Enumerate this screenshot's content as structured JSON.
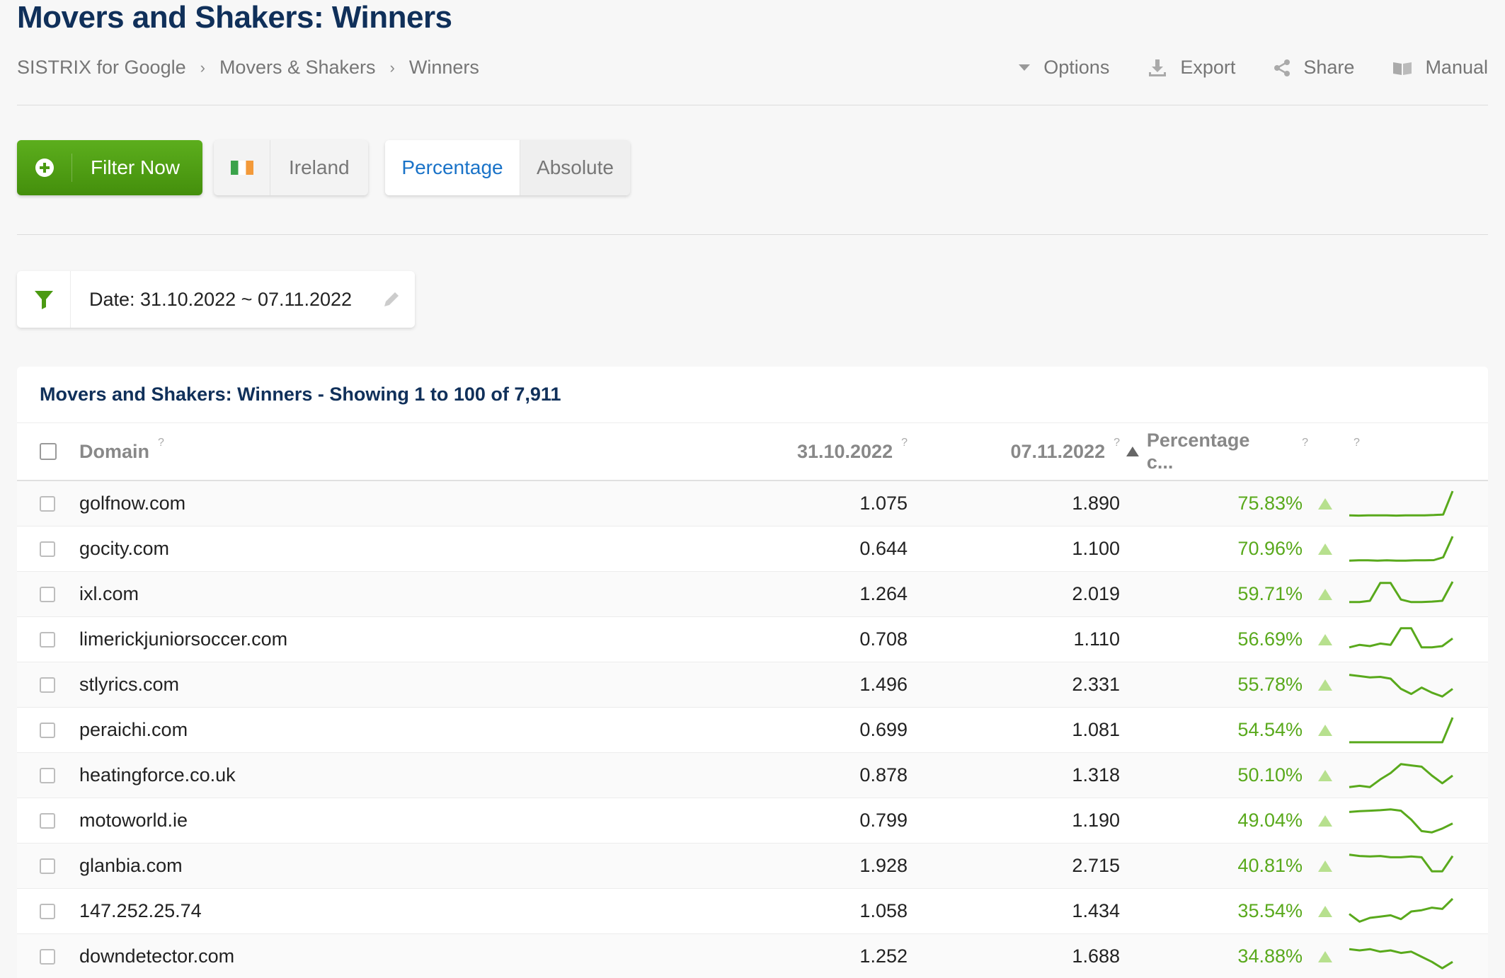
{
  "header": {
    "title": "Movers and Shakers: Winners",
    "breadcrumb": [
      "SISTRIX for Google",
      "Movers & Shakers",
      "Winners"
    ],
    "tools": {
      "options": "Options",
      "export": "Export",
      "share": "Share",
      "manual": "Manual"
    }
  },
  "controls": {
    "filter_button": "Filter Now",
    "country": "Ireland",
    "mode_active": "Percentage",
    "mode_inactive": "Absolute",
    "date_filter": "Date: 31.10.2022 ~ 07.11.2022"
  },
  "colors": {
    "accent_green": "#59a91c",
    "title_blue": "#10305a",
    "link_blue": "#1a73c8"
  },
  "table": {
    "caption": "Movers and Shakers: Winners - Showing 1 to 100 of 7,911",
    "headers": {
      "domain": "Domain",
      "date1": "31.10.2022",
      "date2": "07.11.2022",
      "change": "Percentage c...",
      "help": "?"
    },
    "rows": [
      {
        "domain": "golfnow.com",
        "v1": "1.075",
        "v2": "1.890",
        "pct": "75.83%",
        "spark": [
          0.05,
          0.04,
          0.05,
          0.05,
          0.05,
          0.04,
          0.05,
          0.05,
          0.05,
          0.06,
          0.08,
          1.0
        ]
      },
      {
        "domain": "gocity.com",
        "v1": "0.644",
        "v2": "1.100",
        "pct": "70.96%",
        "spark": [
          0.05,
          0.06,
          0.06,
          0.05,
          0.06,
          0.05,
          0.05,
          0.06,
          0.06,
          0.07,
          0.18,
          1.0
        ]
      },
      {
        "domain": "ixl.com",
        "v1": "1.264",
        "v2": "2.019",
        "pct": "59.71%",
        "spark": [
          0.2,
          0.2,
          0.25,
          0.95,
          0.95,
          0.3,
          0.2,
          0.2,
          0.22,
          0.25,
          1.0
        ]
      },
      {
        "domain": "limerickjuniorsoccer.com",
        "v1": "0.708",
        "v2": "1.110",
        "pct": "56.69%",
        "spark": [
          0.2,
          0.3,
          0.25,
          0.35,
          0.3,
          0.95,
          0.95,
          0.2,
          0.2,
          0.25,
          0.55
        ]
      },
      {
        "domain": "stlyrics.com",
        "v1": "1.496",
        "v2": "2.331",
        "pct": "55.78%",
        "spark": [
          0.9,
          0.85,
          0.8,
          0.82,
          0.75,
          0.35,
          0.15,
          0.4,
          0.2,
          0.05,
          0.35
        ]
      },
      {
        "domain": "peraichi.com",
        "v1": "0.699",
        "v2": "1.081",
        "pct": "54.54%",
        "spark": [
          0.03,
          0.03,
          0.03,
          0.03,
          0.03,
          0.03,
          0.03,
          0.03,
          0.03,
          0.03,
          1.0
        ]
      },
      {
        "domain": "heatingforce.co.uk",
        "v1": "0.878",
        "v2": "1.318",
        "pct": "50.10%",
        "spark": [
          0.05,
          0.1,
          0.05,
          0.35,
          0.6,
          0.95,
          0.9,
          0.85,
          0.5,
          0.2,
          0.5
        ]
      },
      {
        "domain": "motoworld.ie",
        "v1": "0.799",
        "v2": "1.190",
        "pct": "49.04%",
        "spark": [
          0.85,
          0.88,
          0.9,
          0.92,
          0.95,
          0.9,
          0.55,
          0.1,
          0.05,
          0.2,
          0.4
        ]
      },
      {
        "domain": "glanbia.com",
        "v1": "1.928",
        "v2": "2.715",
        "pct": "40.81%",
        "spark": [
          0.95,
          0.9,
          0.88,
          0.9,
          0.85,
          0.85,
          0.88,
          0.85,
          0.3,
          0.3,
          0.9
        ]
      },
      {
        "domain": "147.252.25.74",
        "v1": "1.058",
        "v2": "1.434",
        "pct": "35.54%",
        "spark": [
          0.4,
          0.1,
          0.25,
          0.3,
          0.35,
          0.2,
          0.5,
          0.55,
          0.65,
          0.6,
          1.0
        ]
      },
      {
        "domain": "downdetector.com",
        "v1": "1.252",
        "v2": "1.688",
        "pct": "34.88%",
        "spark": [
          0.8,
          0.75,
          0.8,
          0.7,
          0.75,
          0.65,
          0.7,
          0.5,
          0.3,
          0.05,
          0.3
        ]
      }
    ]
  }
}
